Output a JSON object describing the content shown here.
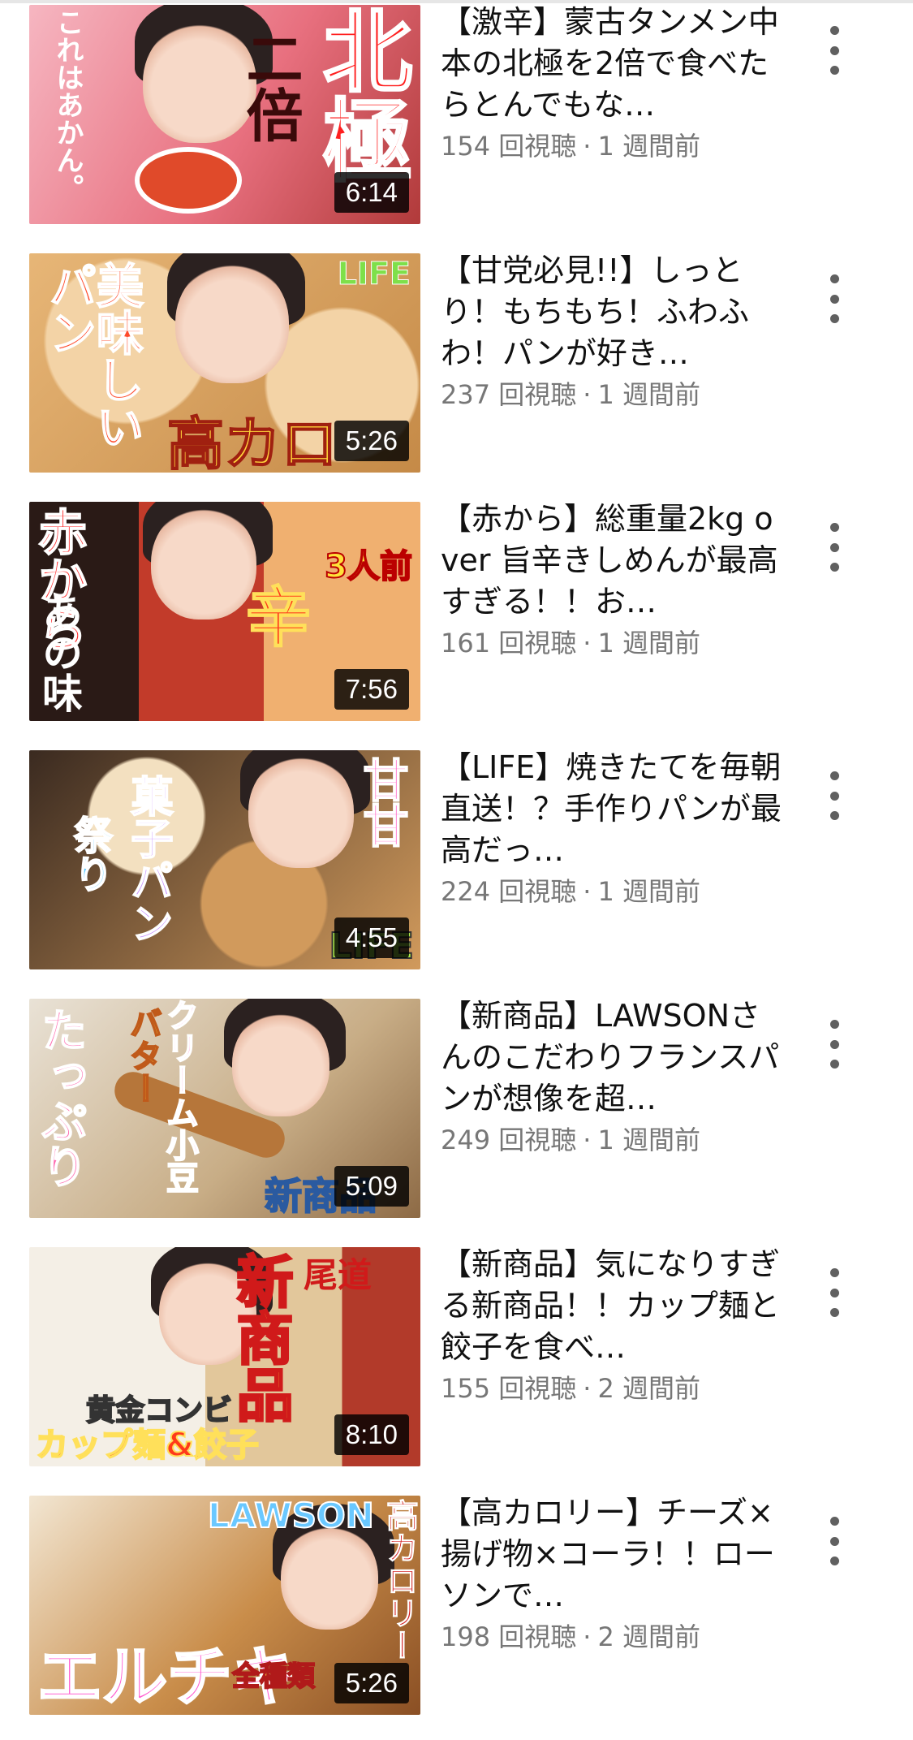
{
  "colors": {
    "title": "#111111",
    "meta": "#777777",
    "badge_bg": "#000000",
    "badge_text": "#ffffff",
    "more_icon": "#606060"
  },
  "more_icon": "vertical-ellipsis-icon",
  "videos": [
    {
      "title": "【激辛】蒙古タンメン中本の北極を2倍で食べたらとんでもな…",
      "views": "154 回視聴",
      "separator": "·",
      "age": "1 週間前",
      "duration": "6:14",
      "thumb": {
        "captions": [
          "北極",
          "二倍",
          "これはあかん。"
        ],
        "bg": [
          "#f6b6c1",
          "#e8707f",
          "#b13a3a"
        ]
      }
    },
    {
      "title": "【甘党必見!!】しっとり！もちもち！ふわふわ！パンが好き…",
      "views": "237 回視聴",
      "separator": "·",
      "age": "1 週間前",
      "duration": "5:26",
      "thumb": {
        "captions": [
          "美味しいパン",
          "高カロ",
          "LIFE"
        ],
        "bg": [
          "#f3d3a6",
          "#e7b677",
          "#c58a47"
        ]
      }
    },
    {
      "title": "【赤から】総重量2kg over 旨辛きしめんが最高すぎる！！お…",
      "views": "161 回視聴",
      "separator": "·",
      "age": "1 週間前",
      "duration": "7:56",
      "thumb": {
        "captions": [
          "赤から",
          "あの味",
          "辛",
          "3人前"
        ],
        "bg": [
          "#2a1a16",
          "#c23b2a",
          "#f0b070"
        ]
      }
    },
    {
      "title": "【LIFE】焼きたてを毎朝直送！？手作りパンが最高だっ…",
      "views": "224 回視聴",
      "separator": "·",
      "age": "1 週間前",
      "duration": "4:55",
      "thumb": {
        "captions": [
          "菓子パン",
          "祭り",
          "甘甘",
          "LIFE"
        ],
        "bg": [
          "#3a2a20",
          "#d19a5c",
          "#f3e0c0"
        ]
      }
    },
    {
      "title": "【新商品】LAWSONさんのこだわりフランスパンが想像を超…",
      "views": "249 回視聴",
      "separator": "·",
      "age": "1 週間前",
      "duration": "5:09",
      "thumb": {
        "captions": [
          "たっぷり",
          "バター",
          "クリーム小豆",
          "新商品"
        ],
        "bg": [
          "#e9e2d6",
          "#c8ad86",
          "#8d6a45"
        ]
      }
    },
    {
      "title": "【新商品】気になりすぎる新商品！！カップ麺と餃子を食べ…",
      "views": "155 回視聴",
      "separator": "·",
      "age": "2 週間前",
      "duration": "8:10",
      "thumb": {
        "captions": [
          "新商品",
          "黄金コンビ",
          "カップ麺&餃子",
          "尾道"
        ],
        "bg": [
          "#f4efe6",
          "#e2c79b",
          "#b23a2a"
        ]
      }
    },
    {
      "title": "【高カロリー】チーズ×揚げ物×コーラ！！ローソンで…",
      "views": "198 回視聴",
      "separator": "·",
      "age": "2 週間前",
      "duration": "5:26",
      "thumb": {
        "captions": [
          "エルチキ",
          "全種類",
          "LAWSON",
          "高カロリー"
        ],
        "bg": [
          "#f2e6d2",
          "#c98d4a",
          "#8a4f24"
        ]
      }
    }
  ]
}
